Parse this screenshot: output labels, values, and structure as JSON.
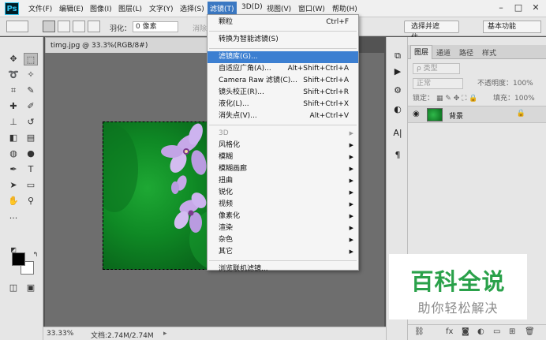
{
  "menubar": {
    "logo": "Ps",
    "items": [
      "文件(F)",
      "编辑(E)",
      "图像(I)",
      "图层(L)",
      "文字(Y)",
      "选择(S)",
      "滤镜(T)",
      "3D(D)",
      "视图(V)",
      "窗口(W)",
      "帮助(H)"
    ],
    "active_index": 6,
    "window_controls": [
      "–",
      "□",
      "✕"
    ]
  },
  "options_bar": {
    "feather_label": "羽化：",
    "feather_value": "0 像素",
    "antialias_label": "消除锯齿",
    "style_label": "样式：",
    "select_mask_button": "选择并遮住...",
    "workspace_select": "基本功能"
  },
  "document": {
    "tab_title": "timg.jpg @ 33.3%(RGB/8#)",
    "close_glyph": "×",
    "zoom": "33.33%",
    "doc_info": "文档:2.74M/2.74M"
  },
  "filter_menu": {
    "items": [
      {
        "label": "颗粒",
        "shortcut": "Ctrl+F"
      },
      {
        "sep": true
      },
      {
        "label": "转换为智能滤镜(S)"
      },
      {
        "sep": true
      },
      {
        "label": "滤镜库(G)...",
        "highlight": true
      },
      {
        "label": "自适应广角(A)...",
        "shortcut": "Alt+Shift+Ctrl+A"
      },
      {
        "label": "Camera Raw 滤镜(C)...",
        "shortcut": "Shift+Ctrl+A"
      },
      {
        "label": "镜头校正(R)...",
        "shortcut": "Shift+Ctrl+R"
      },
      {
        "label": "液化(L)...",
        "shortcut": "Shift+Ctrl+X"
      },
      {
        "label": "消失点(V)...",
        "shortcut": "Alt+Ctrl+V"
      },
      {
        "sep": true
      },
      {
        "label": "3D",
        "submenu": true,
        "disabled": true
      },
      {
        "label": "风格化",
        "submenu": true
      },
      {
        "label": "模糊",
        "submenu": true
      },
      {
        "label": "模糊画廊",
        "submenu": true
      },
      {
        "label": "扭曲",
        "submenu": true
      },
      {
        "label": "锐化",
        "submenu": true
      },
      {
        "label": "视频",
        "submenu": true
      },
      {
        "label": "像素化",
        "submenu": true
      },
      {
        "label": "渲染",
        "submenu": true
      },
      {
        "label": "杂色",
        "submenu": true
      },
      {
        "label": "其它",
        "submenu": true
      },
      {
        "sep": true
      },
      {
        "label": "浏览联机滤镜..."
      }
    ]
  },
  "layers_panel": {
    "tabs": [
      "图层",
      "通道",
      "路径",
      "样式"
    ],
    "filter_placeholder": "ρ 类型",
    "blend_mode": "正常",
    "opacity_label": "不透明度：100%",
    "lock_label": "锁定：",
    "fill_label": "填充：100%",
    "layer_name": "背景"
  },
  "watermark": {
    "title": "百科全说",
    "subtitle": "助你轻松解决"
  },
  "colors": {
    "menu_highlight": "#3c7fd1",
    "watermark_green": "#2aa14a",
    "canvas_bg": "#6e6e6e"
  }
}
